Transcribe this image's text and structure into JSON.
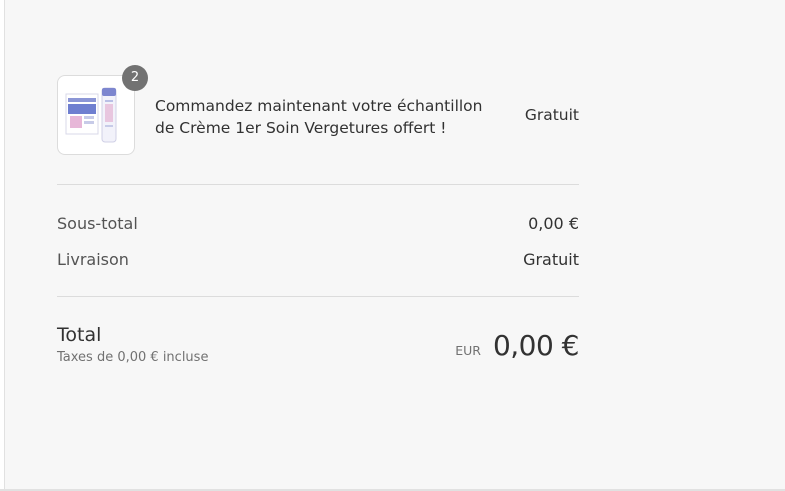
{
  "line_item": {
    "quantity": "2",
    "title": "Commandez maintenant votre échantillon de Crème 1er Soin Vergetures offert !",
    "price": "Gratuit"
  },
  "subtotal": {
    "label": "Sous-total",
    "value": "0,00 €"
  },
  "shipping": {
    "label": "Livraison",
    "value": "Gratuit"
  },
  "total": {
    "label": "Total",
    "tax_note": "Taxes de 0,00 € incluse",
    "currency": "EUR",
    "amount": "0,00 €"
  },
  "colors": {
    "background": "#f7f7f7",
    "badge": "#727272",
    "text": "#323232",
    "muted": "#717171",
    "product_accent": "#5b6bc0"
  }
}
